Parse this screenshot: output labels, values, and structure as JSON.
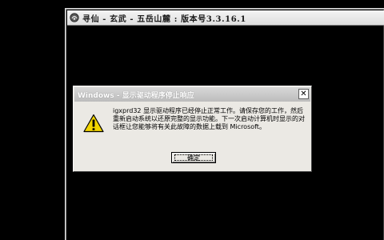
{
  "game_window": {
    "title": "寻仙 - 玄武 - 五岳山麓 : 版本号3.3.16.1"
  },
  "dialog": {
    "title": "Windows - 显示驱动程序停止响应",
    "close_glyph": "✕",
    "message": "igxprd32 显示驱动程序已经停止正常工作。请保存您的工作，然后重新启动系统以还原完整的显示功能。下一次启动计算机时显示的对话框让您能够将有关此故障的数据上载到 Microsoft。",
    "ok_label": "确定",
    "icon": "warning-icon"
  },
  "colors": {
    "desktop": "#000000",
    "dialog_face": "#ebe9e4",
    "warning_yellow": "#f2d500"
  }
}
